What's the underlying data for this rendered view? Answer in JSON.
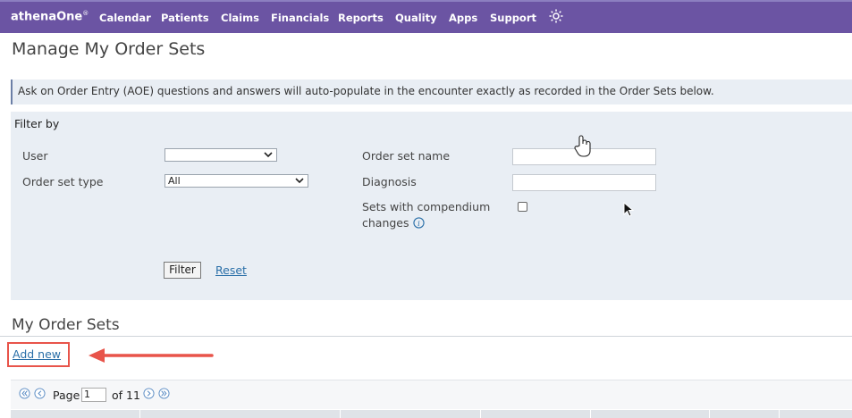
{
  "app": {
    "logo": "athenaOne",
    "logo_mark": "®"
  },
  "nav": {
    "items": [
      "Calendar",
      "Patients",
      "Claims",
      "Financials",
      "Reports",
      "Quality",
      "Apps",
      "Support"
    ],
    "gear_icon": "gear-icon"
  },
  "page": {
    "title": "Manage My Order Sets",
    "notice": "Ask on Order Entry (AOE) questions and answers will auto-populate in the encounter exactly as recorded in the Order Sets below."
  },
  "filter": {
    "title": "Filter by",
    "user_label": "User",
    "user_value": "",
    "order_set_type_label": "Order set type",
    "order_set_type_value": "All",
    "order_set_name_label": "Order set name",
    "order_set_name_value": "",
    "diagnosis_label": "Diagnosis",
    "diagnosis_value": "",
    "compendium_label_line1": "Sets with compendium",
    "compendium_label_line2": "changes",
    "compendium_checked": false,
    "filter_button": "Filter",
    "reset_link": "Reset"
  },
  "order_sets": {
    "title": "My Order Sets",
    "add_new": "Add new"
  },
  "pager": {
    "page_label": "Page",
    "current_page": "1",
    "of_label": "of 11"
  },
  "colors": {
    "nav_background": "#6b54a3",
    "panel_background": "#e9eef4",
    "link": "#2a6fa8",
    "highlight": "#e8544a"
  }
}
